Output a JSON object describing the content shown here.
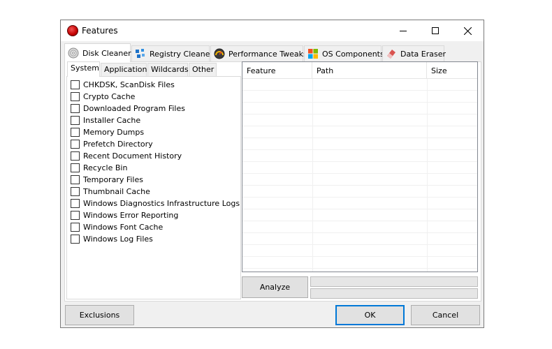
{
  "window": {
    "title": "Features",
    "app_icon": "red-circle-icon"
  },
  "main_tabs": [
    {
      "label": "Disk Cleaner",
      "icon": "disc-icon",
      "active": true
    },
    {
      "label": "Registry Cleaner",
      "icon": "registry-cubes-icon"
    },
    {
      "label": "Performance Tweaks",
      "icon": "gauge-icon"
    },
    {
      "label": "OS Components",
      "icon": "windows-logo-icon"
    },
    {
      "label": "Data Eraser",
      "icon": "eraser-icon"
    }
  ],
  "sub_tabs": [
    {
      "label": "System",
      "active": true
    },
    {
      "label": "Applications"
    },
    {
      "label": "Wildcards"
    },
    {
      "label": "Other"
    }
  ],
  "system_items": [
    "CHKDSK, ScanDisk Files",
    "Crypto Cache",
    "Downloaded Program Files",
    "Installer Cache",
    "Memory Dumps",
    "Prefetch Directory",
    "Recent Document History",
    "Recycle Bin",
    "Temporary Files",
    "Thumbnail Cache",
    "Windows Diagnostics Infrastructure Logs",
    "Windows Error Reporting",
    "Windows Font Cache",
    "Windows Log Files"
  ],
  "list_columns": [
    "Feature",
    "Path",
    "Size"
  ],
  "buttons": {
    "analyze": "Analyze",
    "exclusions": "Exclusions",
    "ok": "OK",
    "cancel": "Cancel"
  },
  "colors": {
    "accent": "#0078d7",
    "app_icon": "#c40000"
  }
}
